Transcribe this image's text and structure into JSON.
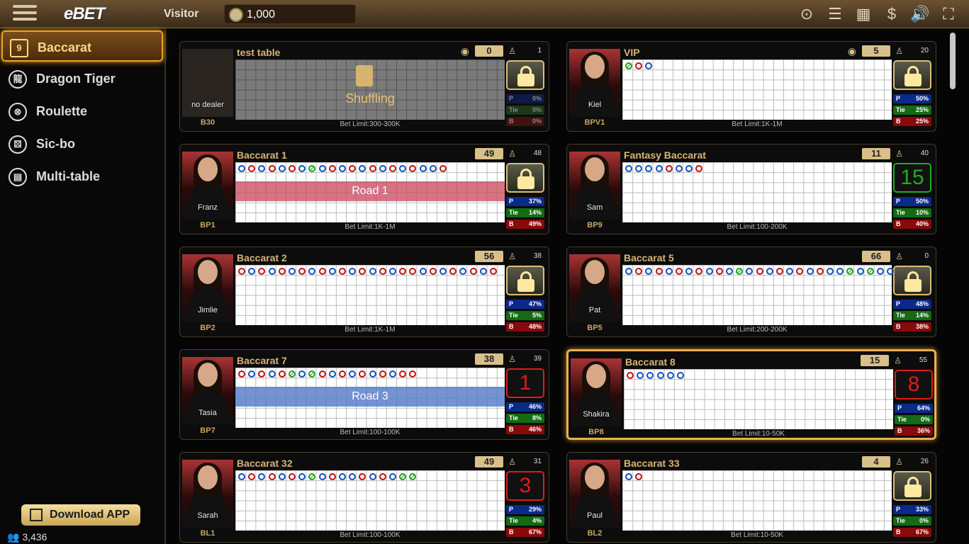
{
  "topbar": {
    "brand": "eBET",
    "visitor": "Visitor",
    "balance": "1,000"
  },
  "nav": [
    {
      "label": "Baccarat",
      "icon": "baccarat-cards-icon",
      "active": true
    },
    {
      "label": "Dragon Tiger",
      "icon": "dragon-tiger-icon",
      "active": false
    },
    {
      "label": "Roulette",
      "icon": "roulette-icon",
      "active": false
    },
    {
      "label": "Sic-bo",
      "icon": "dice-icon",
      "active": false
    },
    {
      "label": "Multi-table",
      "icon": "multi-table-icon",
      "active": false
    }
  ],
  "download_label": "Download APP",
  "online_count": "3,436",
  "colors": {
    "accent": "#f0a020",
    "banker": "#c01010",
    "player": "#1050c0",
    "tie": "#20a020"
  },
  "tables": [
    {
      "title": "test table",
      "code": "B30",
      "dealer": "no dealer",
      "count": "0",
      "players": "1",
      "viewers": true,
      "limit": "Bet Limit:300-300K",
      "status": "Shuffling",
      "lock": true,
      "p": "0%",
      "t": "0%",
      "b": "0%",
      "dim": true
    },
    {
      "title": "VIP",
      "code": "BPV1",
      "dealer": "Kiel",
      "count": "5",
      "players": "20",
      "viewers": true,
      "limit": "Bet Limit:1K-1M",
      "lock": true,
      "p": "50%",
      "t": "25%",
      "b": "25%"
    },
    {
      "title": "Baccarat 1",
      "code": "BP1",
      "dealer": "Franz",
      "count": "49",
      "players": "48",
      "limit": "Bet Limit:1K-1M",
      "overlay": "Road 1",
      "overlay_color": "red",
      "lock": true,
      "p": "37%",
      "t": "14%",
      "b": "49%"
    },
    {
      "title": "Fantasy Baccarat",
      "code": "BP9",
      "dealer": "Sam",
      "count": "11",
      "players": "40",
      "limit": "Bet Limit:100-200K",
      "timer": "15",
      "timer_color": "green",
      "p": "50%",
      "t": "10%",
      "b": "40%"
    },
    {
      "title": "Baccarat 2",
      "code": "BP2",
      "dealer": "Jimlie",
      "count": "56",
      "players": "38",
      "limit": "Bet Limit:1K-1M",
      "lock": true,
      "p": "47%",
      "t": "5%",
      "b": "48%"
    },
    {
      "title": "Baccarat 5",
      "code": "BP5",
      "dealer": "Pat",
      "count": "66",
      "players": "0",
      "limit": "Bet Limit:200-200K",
      "lock": true,
      "p": "48%",
      "t": "14%",
      "b": "38%"
    },
    {
      "title": "Baccarat 7",
      "code": "BP7",
      "dealer": "Tasia",
      "count": "38",
      "players": "39",
      "limit": "Bet Limit:100-100K",
      "overlay": "Road 3",
      "overlay_color": "blue",
      "timer": "1",
      "timer_color": "red",
      "p": "46%",
      "t": "8%",
      "b": "46%"
    },
    {
      "title": "Baccarat 8",
      "code": "BP8",
      "dealer": "Shakira",
      "count": "15",
      "players": "55",
      "limit": "Bet Limit:10-50K",
      "timer": "8",
      "timer_color": "red",
      "highlight": true,
      "p": "64%",
      "t": "0%",
      "b": "36%"
    },
    {
      "title": "Baccarat 32",
      "code": "BL1",
      "dealer": "Sarah",
      "count": "49",
      "players": "31",
      "limit": "Bet Limit:100-100K",
      "timer": "3",
      "timer_color": "red",
      "p": "29%",
      "t": "4%",
      "b": "67%"
    },
    {
      "title": "Baccarat 33",
      "code": "BL2",
      "dealer": "Paul",
      "count": "4",
      "players": "26",
      "limit": "Bet Limit:10-50K",
      "lock": true,
      "p": "33%",
      "t": "0%",
      "b": "67%"
    }
  ]
}
